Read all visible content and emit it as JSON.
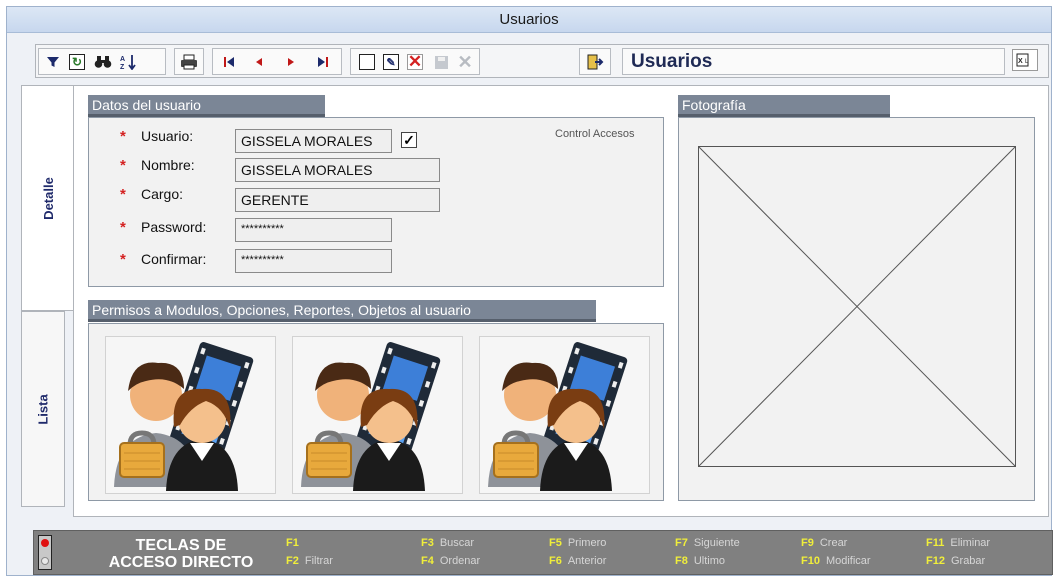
{
  "window": {
    "title": "Usuarios"
  },
  "toolbar": {
    "title": "Usuarios",
    "icons": [
      "filter-icon",
      "refresh-icon",
      "binoculars-icon",
      "sort-icon",
      "print-icon",
      "first-record-icon",
      "previous-record-icon",
      "next-record-icon",
      "last-record-icon",
      "new-icon",
      "edit-icon",
      "delete-icon",
      "save-icon",
      "cancel-icon",
      "exit-icon",
      "export-excel-icon"
    ]
  },
  "tabs": {
    "detail": "Detalle",
    "list": "Lista"
  },
  "user_section": {
    "title": "Datos del usuario",
    "control_label": "Control Accesos",
    "control_checked": true,
    "required_mark": "*",
    "fields": {
      "usuario": {
        "label": "Usuario:",
        "value": "GISSELA MORALES"
      },
      "nombre": {
        "label": "Nombre:",
        "value": "GISSELA MORALES"
      },
      "cargo": {
        "label": "Cargo:",
        "value": "GERENTE"
      },
      "password": {
        "label": "Password:",
        "value": "**********"
      },
      "confirmar": {
        "label": "Confirmar:",
        "value": "**********"
      }
    }
  },
  "photo_section": {
    "title": "Fotografía"
  },
  "permissions_section": {
    "title": "Permisos a Modulos, Opciones, Reportes, Objetos al usuario"
  },
  "shortcuts": {
    "title_line1": "TECLAS DE",
    "title_line2": "ACCESO DIRECTO",
    "keys": [
      {
        "key": "F1",
        "label": ""
      },
      {
        "key": "F2",
        "label": "Filtrar"
      },
      {
        "key": "F3",
        "label": "Buscar"
      },
      {
        "key": "F4",
        "label": "Ordenar"
      },
      {
        "key": "F5",
        "label": "Primero"
      },
      {
        "key": "F6",
        "label": "Anterior"
      },
      {
        "key": "F7",
        "label": "Siguiente"
      },
      {
        "key": "F8",
        "label": "Ultimo"
      },
      {
        "key": "F9",
        "label": "Crear"
      },
      {
        "key": "F10",
        "label": "Modificar"
      },
      {
        "key": "F11",
        "label": "Eliminar"
      },
      {
        "key": "F12",
        "label": "Grabar"
      }
    ]
  },
  "colors": {
    "section_header": "#7b8696",
    "required": "#d42121",
    "key_highlight": "#f0ee3a",
    "footer": "#808080"
  }
}
